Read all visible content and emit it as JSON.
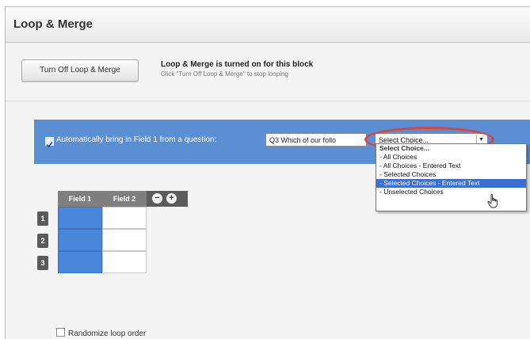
{
  "header": {
    "title": "Loop & Merge"
  },
  "toolbar": {
    "turn_off_label": "Turn Off Loop & Merge",
    "status_title": "Loop & Merge is turned on for this block",
    "status_subtitle": "Click \"Turn Off Loop & Merge\" to stop looping"
  },
  "auto_bring": {
    "checked": true,
    "label": "Automatically bring in Field 1 from a question:",
    "question_value": "Q3 Which of our follo",
    "choice_value": "Select Choice..."
  },
  "dropdown": {
    "options": [
      "Select Choice...",
      "- All Choices",
      "- All Choices - Entered Text",
      "- Selected Choices",
      "- Selected Choices - Entered Text",
      "- Unselected Choices"
    ],
    "highlighted": "- Selected Choices - Entered Text"
  },
  "grid": {
    "headers": [
      "Field 1",
      "Field 2"
    ],
    "remove_symbol": "−",
    "add_symbol": "+",
    "rows": [
      "1",
      "2",
      "3"
    ]
  },
  "options": {
    "randomize_label": "Randomize loop order"
  },
  "colors": {
    "accent_blue": "#5b8fd4",
    "field1_blue": "#4a86d9",
    "highlight_red": "#d9463c",
    "selected_item": "#3b6fd0"
  },
  "icons": [
    "checkbox-icon",
    "dropdown-arrow-icon",
    "minus-circle-icon",
    "plus-circle-icon",
    "hand-cursor-icon"
  ]
}
